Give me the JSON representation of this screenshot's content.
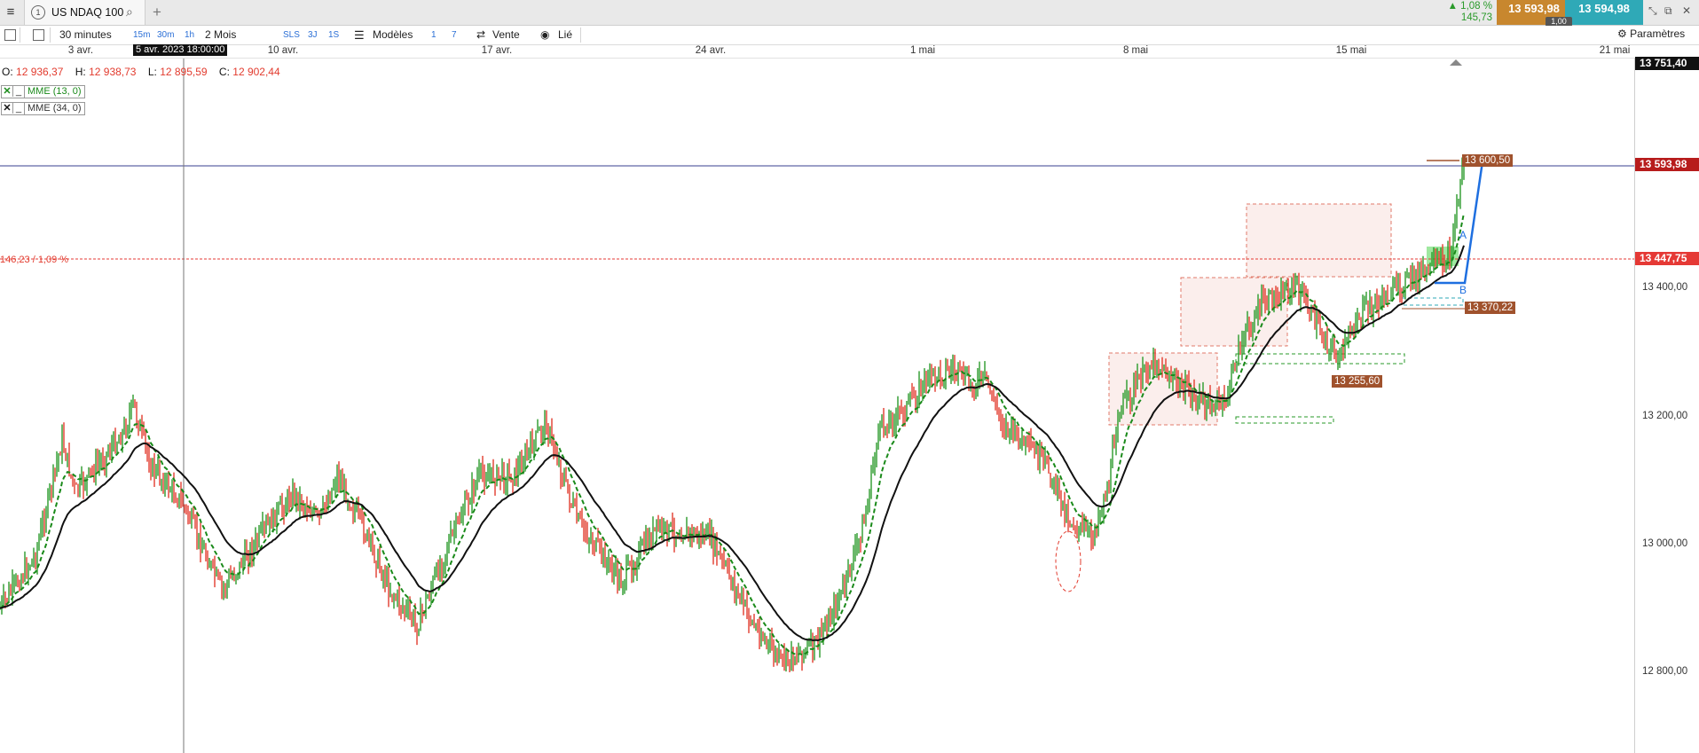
{
  "tabbar": {
    "tab_number": "1",
    "instrument": "US NDAQ 100",
    "change_pct": "▲ 1,08 %",
    "change_abs": "145,73",
    "bid": "13 593,98",
    "ask": "13 594,98",
    "spread": "1,00"
  },
  "toolbar": {
    "interval": "30 minutes",
    "quick_intervals": [
      "15m",
      "30m",
      "1h"
    ],
    "period": "2 Mois",
    "period_shortcuts": [
      "SLS",
      "3J",
      "1S"
    ],
    "models_label": "Modèles",
    "counts": [
      "1",
      "7"
    ],
    "sell_label": "Vente",
    "linked_label": "Lié",
    "settings_label": "Paramètres"
  },
  "date_axis": {
    "labels": [
      "3 avr.",
      "10 avr.",
      "17 avr.",
      "24 avr.",
      "1 mai",
      "8 mai",
      "15 mai",
      "21 mai"
    ],
    "cursor_tooltip": "5 avr. 2023 18:00:00"
  },
  "ohlc": {
    "open_label": "O:",
    "open": "12 936,37",
    "high_label": "H:",
    "high": "12 938,73",
    "low_label": "L:",
    "low": "12 895,59",
    "close_label": "C:",
    "close": "12 902,44"
  },
  "indicators": [
    {
      "name": "MME (13, 0)",
      "color": "#1a8a1a"
    },
    {
      "name": "MME (34, 0)",
      "color": "#111111"
    }
  ],
  "price_axis": {
    "labels": [
      "13 400,00",
      "13 200,00",
      "13 000,00",
      "12 800,00"
    ],
    "top_price": "13 751,40",
    "current_price": "13 593,98",
    "reference_price": "13 447,75"
  },
  "annotations": {
    "reference_change": "146,23 / 1,09 %",
    "high_marker": "13 600,50",
    "level_1": "13 370,22",
    "level_2": "13 255,60",
    "wave_a": "A",
    "wave_b": "B"
  },
  "colors": {
    "up": "#2a9a2a",
    "down": "#e23b2e",
    "bid": "#c8872e",
    "ask": "#2fa9b7",
    "current_price": "#b71c1c",
    "reference": "#e53935",
    "label": "#a0522d"
  }
}
